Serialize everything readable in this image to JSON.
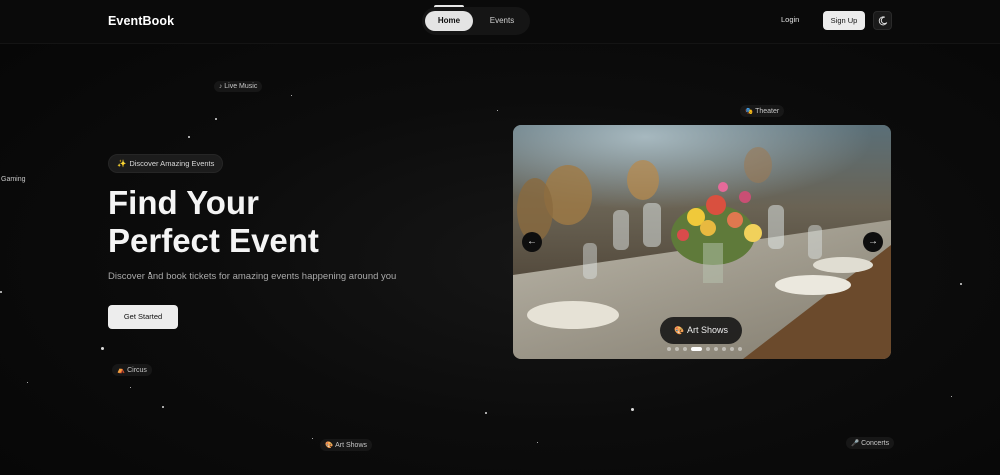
{
  "header": {
    "logo": "EventBook",
    "nav": [
      {
        "label": "Home",
        "active": true
      },
      {
        "label": "Events",
        "active": false
      }
    ],
    "login_label": "Login",
    "signup_label": "Sign Up",
    "theme_icon": "moon-icon"
  },
  "floating_tags": [
    {
      "label": "Live Music",
      "icon": "♪"
    },
    {
      "label": "Theater",
      "icon": "🎭"
    },
    {
      "label": "Gaming",
      "icon": ""
    },
    {
      "label": "Circus",
      "icon": "⛺"
    },
    {
      "label": "Art Shows",
      "icon": "🎨"
    },
    {
      "label": "Concerts",
      "icon": "🎤"
    }
  ],
  "hero": {
    "badge_icon": "✨",
    "badge": "Discover Amazing Events",
    "title_line1": "Find Your",
    "title_line2": "Perfect Event",
    "subtitle": "Discover and book tickets for amazing events happening around you",
    "cta": "Get Started"
  },
  "carousel": {
    "prev_label": "←",
    "next_label": "→",
    "caption_icon": "🎨",
    "caption": "Art Shows",
    "slide_count": 9,
    "active_index": 3
  },
  "colors": {
    "background": "#080808",
    "text": "#f2f2f2",
    "muted": "#a9a9a9",
    "button": "#ededed",
    "accent_spark": "#e6c34a"
  }
}
